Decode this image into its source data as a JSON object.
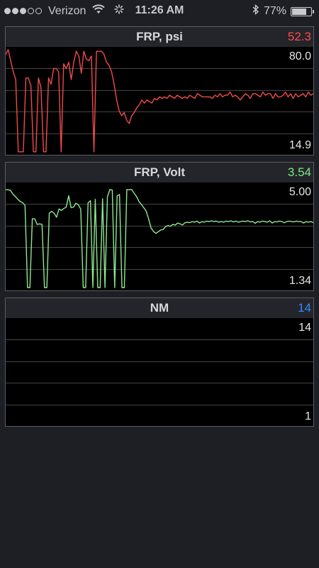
{
  "status_bar": {
    "carrier": "Verizon",
    "time": "11:26 AM",
    "battery_percent": "77%",
    "battery_level": 0.77,
    "signal_bars_filled": 3,
    "signal_bars_total": 5,
    "icons": [
      "wifi-icon",
      "activity-spinner-icon",
      "bluetooth-icon",
      "battery-icon"
    ]
  },
  "panels": [
    {
      "title": "FRP, psi",
      "value": "52.3",
      "value_color": "#ff4b4b",
      "line_color": "#f04a4a",
      "max_label": "80.0",
      "min_label": "14.9",
      "grid_lines": 4,
      "chart_data": {
        "type": "line",
        "ylim": [
          14.9,
          80.0
        ],
        "y": [
          77,
          80,
          73,
          66,
          61,
          15,
          15,
          15,
          62,
          62,
          57,
          15,
          15,
          62,
          56,
          15,
          15,
          62,
          58,
          68,
          68,
          66,
          15,
          71,
          68,
          72,
          61,
          72,
          79,
          76,
          65,
          79,
          74,
          73,
          76,
          15,
          79,
          79,
          79,
          77,
          72,
          70,
          66,
          58,
          48,
          41,
          38,
          40,
          35,
          33,
          38,
          40,
          43,
          45,
          48,
          46,
          48,
          47,
          46,
          49,
          48,
          50,
          49,
          50,
          49,
          51,
          50,
          49,
          51,
          50,
          49,
          50,
          49,
          51,
          50,
          49,
          52,
          51,
          50,
          50,
          50,
          50,
          49,
          51,
          50,
          52,
          50,
          51,
          51,
          53,
          50,
          51,
          50,
          48,
          50,
          52,
          51,
          49,
          52,
          52,
          51,
          50,
          53,
          51,
          52,
          52,
          49,
          52,
          50,
          50,
          51,
          53,
          50,
          52,
          49,
          52,
          50,
          51,
          52,
          50,
          53,
          51,
          52
        ]
      }
    },
    {
      "title": "FRP, Volt",
      "value": "3.54",
      "value_color": "#7de87d",
      "line_color": "#8fe88f",
      "max_label": "5.00",
      "min_label": "1.34",
      "grid_lines": 4,
      "chart_data": {
        "type": "line",
        "ylim": [
          1.34,
          5.0
        ],
        "y": [
          4.84,
          4.84,
          4.82,
          4.68,
          4.6,
          4.5,
          4.42,
          4.38,
          4.28,
          1.34,
          1.34,
          3.8,
          3.8,
          3.6,
          3.62,
          3.6,
          1.34,
          1.34,
          4.0,
          4.07,
          4.0,
          3.86,
          4.15,
          4.1,
          4.17,
          4.22,
          4.63,
          4.2,
          4.22,
          4.36,
          4.3,
          4.15,
          1.34,
          1.34,
          4.37,
          4.45,
          1.34,
          4.5,
          1.34,
          1.34,
          4.52,
          1.34,
          4.58,
          4.85,
          4.83,
          1.34,
          4.62,
          4.67,
          1.34,
          1.34,
          4.85,
          4.84,
          4.85,
          4.72,
          4.6,
          4.42,
          4.32,
          4.2,
          4.08,
          3.8,
          3.48,
          3.35,
          3.28,
          3.34,
          3.4,
          3.42,
          3.52,
          3.56,
          3.53,
          3.6,
          3.58,
          3.65,
          3.62,
          3.58,
          3.66,
          3.68,
          3.66,
          3.7,
          3.68,
          3.72,
          3.65,
          3.7,
          3.68,
          3.72,
          3.7,
          3.73,
          3.7,
          3.72,
          3.68,
          3.7,
          3.68,
          3.72,
          3.7,
          3.73,
          3.69,
          3.72,
          3.68,
          3.7,
          3.72,
          3.7,
          3.73,
          3.69,
          3.7,
          3.64,
          3.7,
          3.68,
          3.72,
          3.7,
          3.68,
          3.73,
          3.65,
          3.7,
          3.69,
          3.72,
          3.7,
          3.66,
          3.7,
          3.72,
          3.7,
          3.69,
          3.72,
          3.7,
          3.7,
          3.65,
          3.7,
          3.68,
          3.7,
          3.66
        ]
      }
    },
    {
      "title": "NM",
      "value": "14",
      "value_color": "#2f8cff",
      "line_color": "#2f8cff",
      "max_label": "14",
      "min_label": "1",
      "grid_lines": 4,
      "chart_data": {
        "type": "line",
        "ylim": [
          1,
          14
        ],
        "y": []
      }
    }
  ]
}
